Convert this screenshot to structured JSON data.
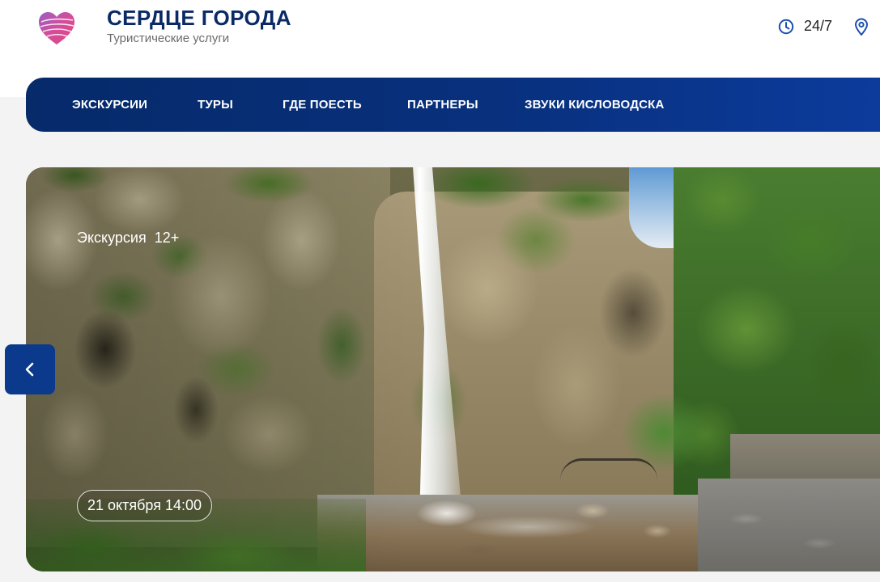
{
  "brand": {
    "title": "СЕРДЦЕ ГОРОДА",
    "subtitle": "Туристические услуги",
    "logo_icon": "heart-logo-icon"
  },
  "header": {
    "hours": "24/7",
    "hours_icon": "clock-icon",
    "location_icon": "location-pin-icon"
  },
  "nav": {
    "items": [
      {
        "label": "ЭКСКУРСИИ"
      },
      {
        "label": "ТУРЫ"
      },
      {
        "label": "ГДЕ ПОЕСТЬ"
      },
      {
        "label": "ПАРТНЕРЫ"
      },
      {
        "label": "ЗВУКИ КИСЛОВОДСКА"
      }
    ]
  },
  "hero": {
    "tag": "Экскурсия",
    "age": "12+",
    "date": "21 октября 14:00",
    "prev_icon": "chevron-left-icon"
  },
  "colors": {
    "brand_navy": "#0a2a66",
    "nav_start": "#062a6a",
    "nav_end": "#0c3b9c",
    "button": "#0b3a8c",
    "icon_blue": "#1c4fb0",
    "page_gray": "#f3f3f4"
  }
}
